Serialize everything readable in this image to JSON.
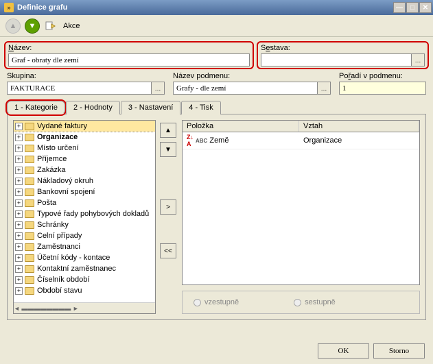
{
  "window": {
    "title": "Definice grafu"
  },
  "toolbar": {
    "akce": "Akce"
  },
  "fields": {
    "nazev_label": "Název:",
    "nazev_value": "Graf - obraty dle zemí",
    "sestava_label": "Sestava:",
    "sestava_value": "",
    "skupina_label": "Skupina:",
    "skupina_value": "FAKTURACE",
    "podmenu_label": "Název podmenu:",
    "podmenu_value": "Grafy - dle zemí",
    "poradi_label": "Pořadí v podmenu:",
    "poradi_value": "1"
  },
  "tabs": [
    "1 - Kategorie",
    "2 - Hodnoty",
    "3 - Nastavení",
    "4 - Tisk"
  ],
  "tree": [
    "Vydané faktury",
    "Organizace",
    "Místo určení",
    "Příjemce",
    "Zakázka",
    "Nákladový okruh",
    "Bankovní spojení",
    "Pošta",
    "Typové řady pohybových dokladů",
    "Schránky",
    "Celní případy",
    "Zaměstnanci",
    "Účetní kódy - kontace",
    "Kontaktní zaměstnanec",
    "Číselník období",
    "Období stavu"
  ],
  "grid": {
    "cols": [
      "Položka",
      "Vztah"
    ],
    "rows": [
      {
        "polozka": "Země",
        "vztah": "Organizace"
      }
    ]
  },
  "sort": {
    "asc": "vzestupně",
    "desc": "sestupně"
  },
  "buttons": {
    "move_right": ">",
    "move_left": "<<",
    "ok": "OK",
    "storno": "Storno"
  }
}
